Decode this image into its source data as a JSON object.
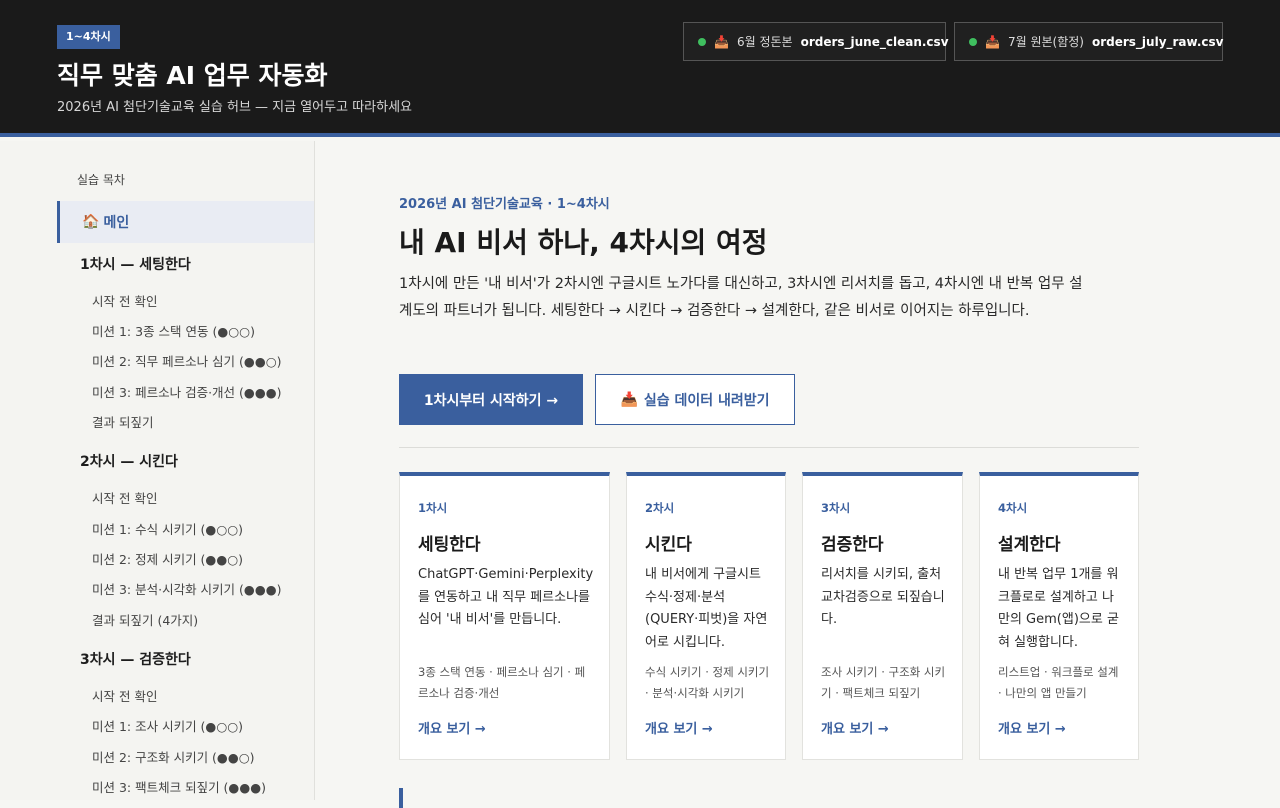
{
  "header": {
    "badge": "1~4차시",
    "title": "직무 맞춤 AI 업무 자동화",
    "subtitle": "2026년 AI 첨단기술교육 실습 허브 — 지금 열어두고 따라하세요",
    "files": [
      {
        "label": "6월 정돈본",
        "filename": "orders_june_clean.csv",
        "icon": "inbox-tray-icon",
        "status_color": "#3fbf5f"
      },
      {
        "label": "7월 원본(함정)",
        "filename": "orders_july_raw.csv",
        "icon": "inbox-tray-icon",
        "status_color": "#3fbf5f"
      }
    ]
  },
  "sidebar": {
    "toc_title": "실습 목차",
    "main_label": "메인",
    "main_icon": "house-icon",
    "sections": [
      {
        "title": "1차시 — 세팅한다",
        "items": [
          "시작 전 확인",
          "미션 1: 3종 스택 연동 (●○○)",
          "미션 2: 직무 페르소나 심기 (●●○)",
          "미션 3: 페르소나 검증·개선 (●●●)",
          "결과 되짚기"
        ]
      },
      {
        "title": "2차시 — 시킨다",
        "items": [
          "시작 전 확인",
          "미션 1: 수식 시키기 (●○○)",
          "미션 2: 정제 시키기 (●●○)",
          "미션 3: 분석·시각화 시키기 (●●●)",
          "결과 되짚기 (4가지)"
        ]
      },
      {
        "title": "3차시 — 검증한다",
        "items": [
          "시작 전 확인",
          "미션 1: 조사 시키기 (●○○)",
          "미션 2: 구조화 시키기 (●●○)",
          "미션 3: 팩트체크 되짚기 (●●●)"
        ]
      }
    ]
  },
  "main": {
    "eyebrow": "2026년 AI 첨단기술교육 · 1~4차시",
    "title": "내 AI 비서 하나, 4차시의 여정",
    "description": "1차시에 만든 '내 비서'가 2차시엔 구글시트 노가다를 대신하고, 3차시엔 리서치를 돕고, 4차시엔 내 반복 업무 설계도의 파트너가 됩니다. 세팅한다 → 시킨다 → 검증한다 → 설계한다, 같은 비서로 이어지는 하루입니다.",
    "primary_button": "1차시부터 시작하기 →",
    "secondary_button": "실습 데이터 내려받기",
    "secondary_icon": "inbox-tray-icon",
    "cards": [
      {
        "step": "1차시",
        "title": "세팅한다",
        "desc": "ChatGPT·Gemini·Perplexity를 연동하고 내 직무 페르소나를 심어 '내 비서'를 만듭니다.",
        "tags": "3종 스택 연동 · 페르소나 심기 · 페르소나 검증·개선",
        "link": "개요 보기 →"
      },
      {
        "step": "2차시",
        "title": "시킨다",
        "desc": "내 비서에게 구글시트 수식·정제·분석(QUERY·피벗)을 자연어로 시킵니다.",
        "tags": "수식 시키기 · 정제 시키기 · 분석·시각화 시키기",
        "link": "개요 보기 →"
      },
      {
        "step": "3차시",
        "title": "검증한다",
        "desc": "리서치를 시키되, 출처 교차검증으로 되짚습니다.",
        "tags": "조사 시키기 · 구조화 시키기 · 팩트체크 되짚기",
        "link": "개요 보기 →"
      },
      {
        "step": "4차시",
        "title": "설계한다",
        "desc": "내 반복 업무 1개를 워크플로로 설계하고 나만의 Gem(앱)으로 굳혀 실행합니다.",
        "tags": "리스트업 · 워크플로 설계 · 나만의 앱 만들기",
        "link": "개요 보기 →"
      }
    ]
  }
}
